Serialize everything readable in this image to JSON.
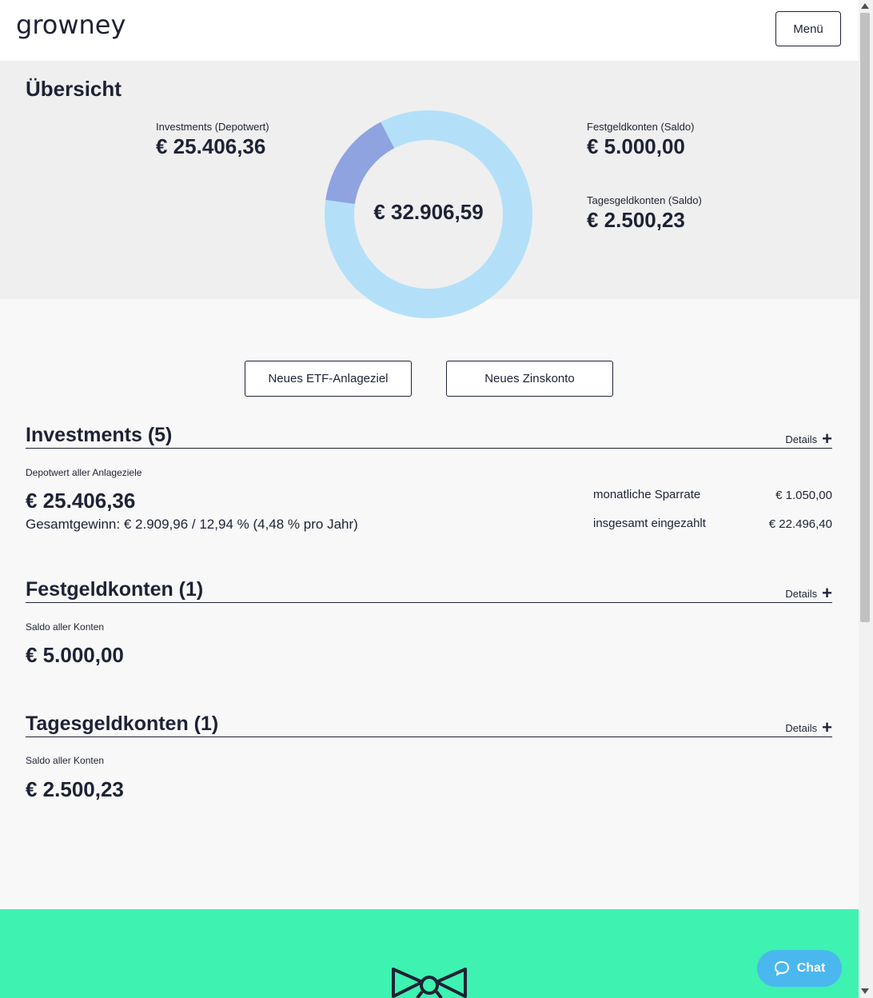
{
  "header": {
    "logo": "growney",
    "menu_label": "Menü"
  },
  "overview": {
    "title": "Übersicht",
    "investments_label": "Investments (Depotwert)",
    "investments_value": "€ 25.406,36",
    "festgeld_label": "Festgeldkonten (Saldo)",
    "festgeld_value": "€ 5.000,00",
    "tagesgeld_label": "Tagesgeldkonten (Saldo)",
    "tagesgeld_value": "€ 2.500,23",
    "total": "€ 32.906,59"
  },
  "chart_data": {
    "type": "pie",
    "categories": [
      "Investments (Depotwert)",
      "Festgeldkonten (Saldo)",
      "Tagesgeldkonten (Saldo)"
    ],
    "values": [
      25406.36,
      5000.0,
      2500.23
    ],
    "colors": [
      "#b3e0f8",
      "#8fa3e0",
      "#b3e0f8"
    ],
    "title": "",
    "center_label": "€ 32.906,59"
  },
  "actions": {
    "new_etf": "Neues ETF-Anlageziel",
    "new_interest": "Neues Zinskonto"
  },
  "investments": {
    "title": "Investments (5)",
    "details": "Details",
    "label": "Depotwert aller Anlageziele",
    "value": "€ 25.406,36",
    "gain": "Gesamtgewinn: € 2.909,96 / 12,94 % (4,48 % pro Jahr)",
    "rows": [
      {
        "label": "monatliche Sparrate",
        "value": "€ 1.050,00"
      },
      {
        "label": "insgesamt eingezahlt",
        "value": "€ 22.496,40"
      }
    ]
  },
  "festgeld": {
    "title": "Festgeldkonten (1)",
    "details": "Details",
    "label": "Saldo aller Konten",
    "value": "€ 5.000,00"
  },
  "tagesgeld": {
    "title": "Tagesgeldkonten (1)",
    "details": "Details",
    "label": "Saldo aller Konten",
    "value": "€ 2.500,23"
  },
  "chat": {
    "label": "Chat"
  },
  "colors": {
    "brand_green": "#3ef2b2",
    "chat_blue": "#4ab8ee",
    "donut_light": "#b3e0f8",
    "donut_dark": "#8fa3e0",
    "text_dark": "#1e2235"
  }
}
